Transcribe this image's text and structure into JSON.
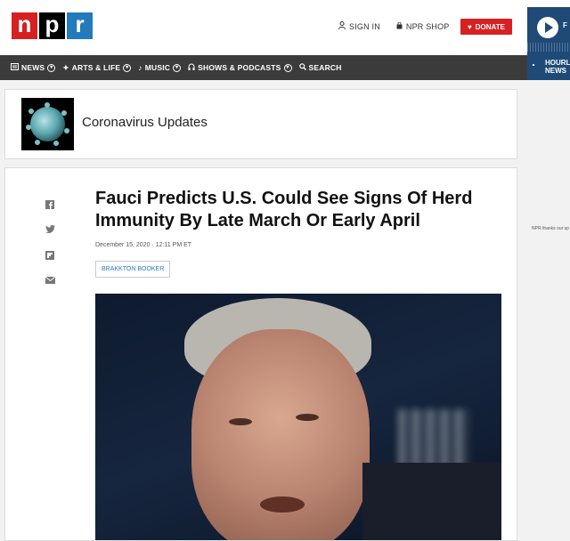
{
  "header": {
    "logo": [
      "n",
      "p",
      "r"
    ],
    "sign_in": "SIGN IN",
    "shop": "NPR SHOP",
    "donate": "DONATE"
  },
  "player": {
    "label_f": "F",
    "hourly_line1": "HOURL",
    "hourly_line2": "NEWS"
  },
  "nav": {
    "items": [
      "NEWS",
      "ARTS & LIFE",
      "MUSIC",
      "SHOWS & PODCASTS",
      "SEARCH"
    ]
  },
  "topic": {
    "title": "Coronavirus Updates"
  },
  "article": {
    "headline": "Fauci Predicts U.S. Could See Signs Of Herd Immunity By Late March Or Early April",
    "date": "December 15, 2020 · 12:11 PM ET",
    "byline": "BRAKKTON BOOKER",
    "share_icons": [
      "facebook-icon",
      "twitter-icon",
      "flipboard-icon",
      "email-icon"
    ]
  },
  "sidebar": {
    "sponsor_text": "NPR thanks our sp"
  },
  "colors": {
    "npr_red": "#d62021",
    "npr_black": "#000000",
    "npr_blue": "#237bbd",
    "nav_bg": "#3b3b3b",
    "player_bg": "#1f4a78"
  }
}
